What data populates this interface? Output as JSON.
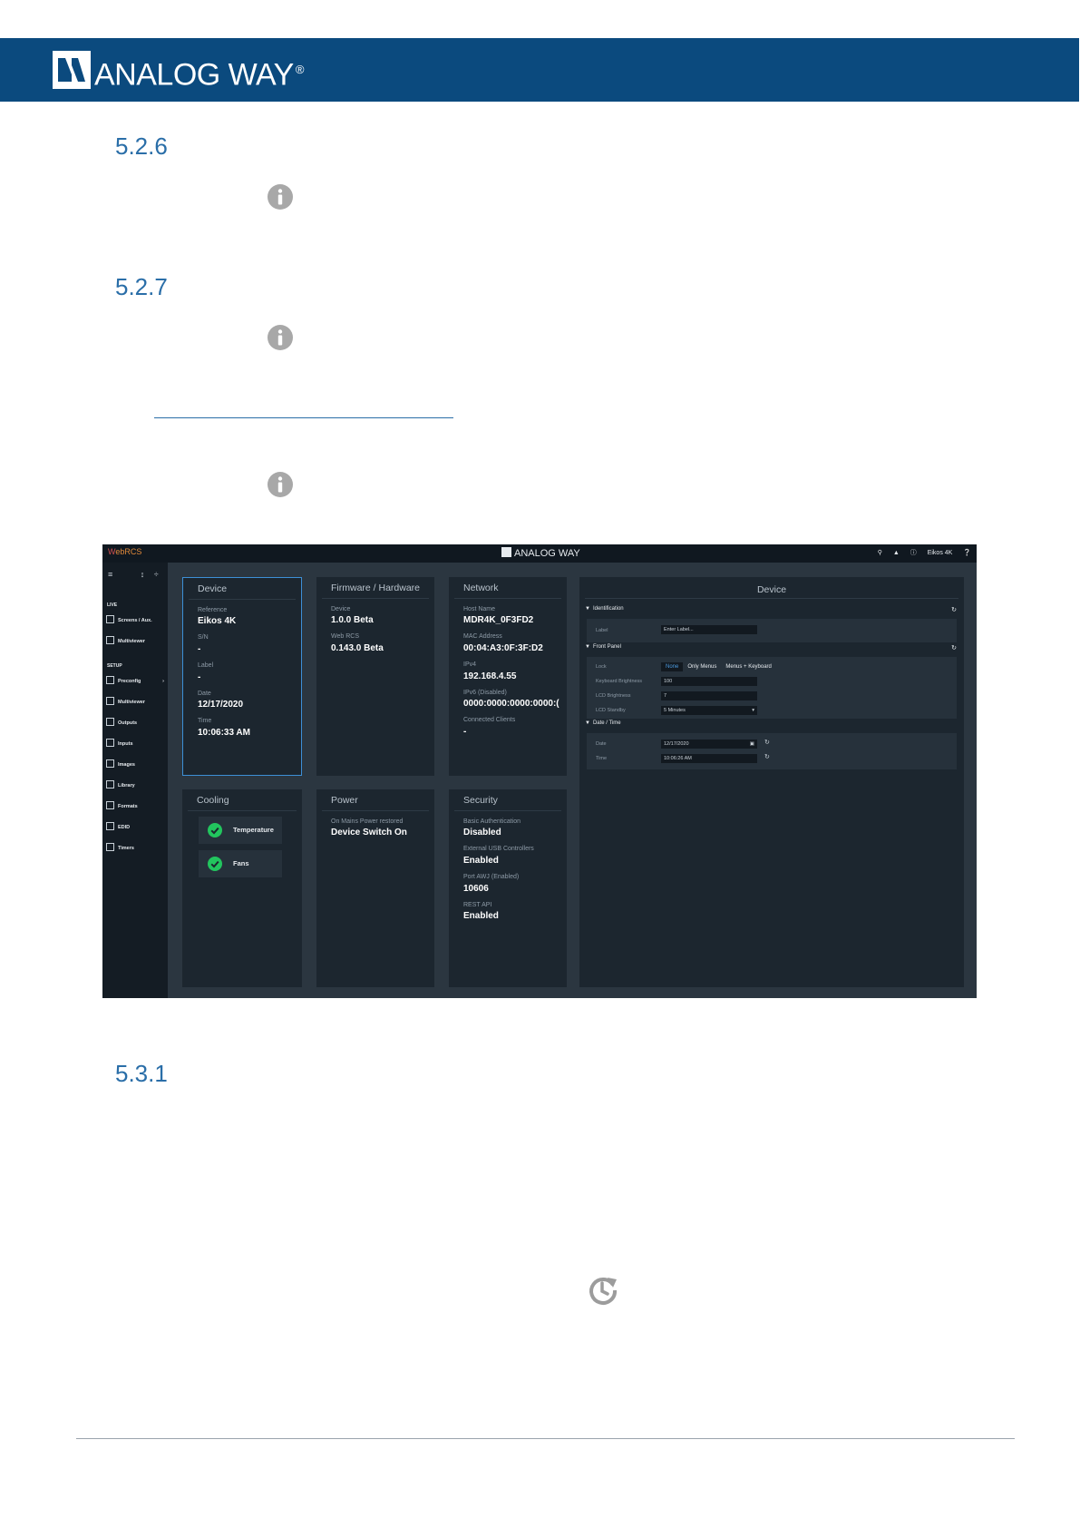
{
  "header": {
    "brand_name": "ANALOG WAY",
    "brand_mark": "®",
    "banner_color": "#0b4a7e"
  },
  "doc": {
    "headings": [
      "5.2.6",
      "5.2.7",
      "5.3.1"
    ],
    "heading_color": "#2a6ea8"
  },
  "screenshot": {
    "topbar": {
      "app_name_a": "W",
      "app_name_b": "ebRCS",
      "logo_text": "ANALOG WAY",
      "device_name": "Eikos 4K"
    },
    "sidebar": {
      "section_live": "LIVE",
      "section_setup": "SETUP",
      "items": [
        "Screens / Aux.",
        "Multiviewer",
        "Preconfig",
        "Multiviewer",
        "Outputs",
        "Inputs",
        "Images",
        "Library",
        "Formats",
        "EDID",
        "Timers"
      ]
    },
    "device": {
      "title": "Device",
      "reference_label": "Reference",
      "reference": "Eikos 4K",
      "sn_label": "S/N",
      "sn": "-",
      "label_label": "Label",
      "label": "-",
      "date_label": "Date",
      "date": "12/17/2020",
      "time_label": "Time",
      "time": "10:06:33 AM"
    },
    "firmware": {
      "title": "Firmware / Hardware",
      "device_label": "Device",
      "device": "1.0.0 Beta",
      "webrcs_label": "Web RCS",
      "webrcs": "0.143.0 Beta"
    },
    "network": {
      "title": "Network",
      "host_label": "Host Name",
      "host": "MDR4K_0F3FD2",
      "mac_label": "MAC Address",
      "mac": "00:04:A3:0F:3F:D2",
      "ipv4_label": "IPv4",
      "ipv4": "192.168.4.55",
      "ipv6_label": "IPv6 (Disabled)",
      "ipv6": "0000:0000:0000:0000:(",
      "clients_label": "Connected Clients",
      "clients": "-"
    },
    "cooling": {
      "title": "Cooling",
      "temperature": "Temperature",
      "fans": "Fans",
      "ok_color": "#22c55e"
    },
    "power": {
      "title": "Power",
      "restore_label": "On Mains Power restored",
      "restore": "Device Switch On"
    },
    "security": {
      "title": "Security",
      "basic_auth_label": "Basic Authentication",
      "basic_auth": "Disabled",
      "usb_label": "External USB Controllers",
      "usb": "Enabled",
      "port_label": "Port AWJ (Enabled)",
      "port": "10606",
      "rest_label": "REST API",
      "rest": "Enabled"
    },
    "panel": {
      "title": "Device",
      "identification": "Identification",
      "label_field_label": "Label",
      "label_placeholder": "Enter Label...",
      "front_panel": "Front Panel",
      "lock_label": "Lock",
      "lock_options": [
        "None",
        "Only Menus",
        "Menus + Keyboard"
      ],
      "kb_brightness_label": "Keyboard Brightness",
      "kb_brightness": "100",
      "lcd_brightness_label": "LCD Brightness",
      "lcd_brightness": "7",
      "lcd_standby_label": "LCD Standby",
      "lcd_standby": "5 Minutes",
      "date_time": "Date / Time",
      "date_label": "Date",
      "date": "12/17/2020",
      "time_label": "Time",
      "time": "10:06:26 AM"
    }
  }
}
